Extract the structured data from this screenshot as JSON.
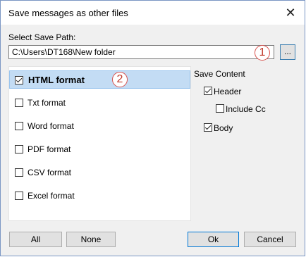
{
  "window": {
    "title": "Save messages as other files"
  },
  "save_path": {
    "label": "Select Save Path:",
    "value": "C:\\Users\\DT168\\New folder",
    "browse_label": "..."
  },
  "callouts": {
    "first": "1",
    "second": "2"
  },
  "formats": [
    {
      "label": "HTML format",
      "checked": true,
      "selected": true
    },
    {
      "label": "Txt format",
      "checked": false
    },
    {
      "label": "Word format",
      "checked": false
    },
    {
      "label": "PDF format",
      "checked": false
    },
    {
      "label": "CSV format",
      "checked": false
    },
    {
      "label": "Excel format",
      "checked": false
    }
  ],
  "save_content": {
    "heading": "Save Content",
    "header_label": "Header",
    "header_checked": true,
    "include_cc_label": "Include Cc",
    "include_cc_checked": false,
    "body_label": "Body",
    "body_checked": true
  },
  "buttons": {
    "all": "All",
    "none": "None",
    "ok": "Ok",
    "cancel": "Cancel"
  }
}
